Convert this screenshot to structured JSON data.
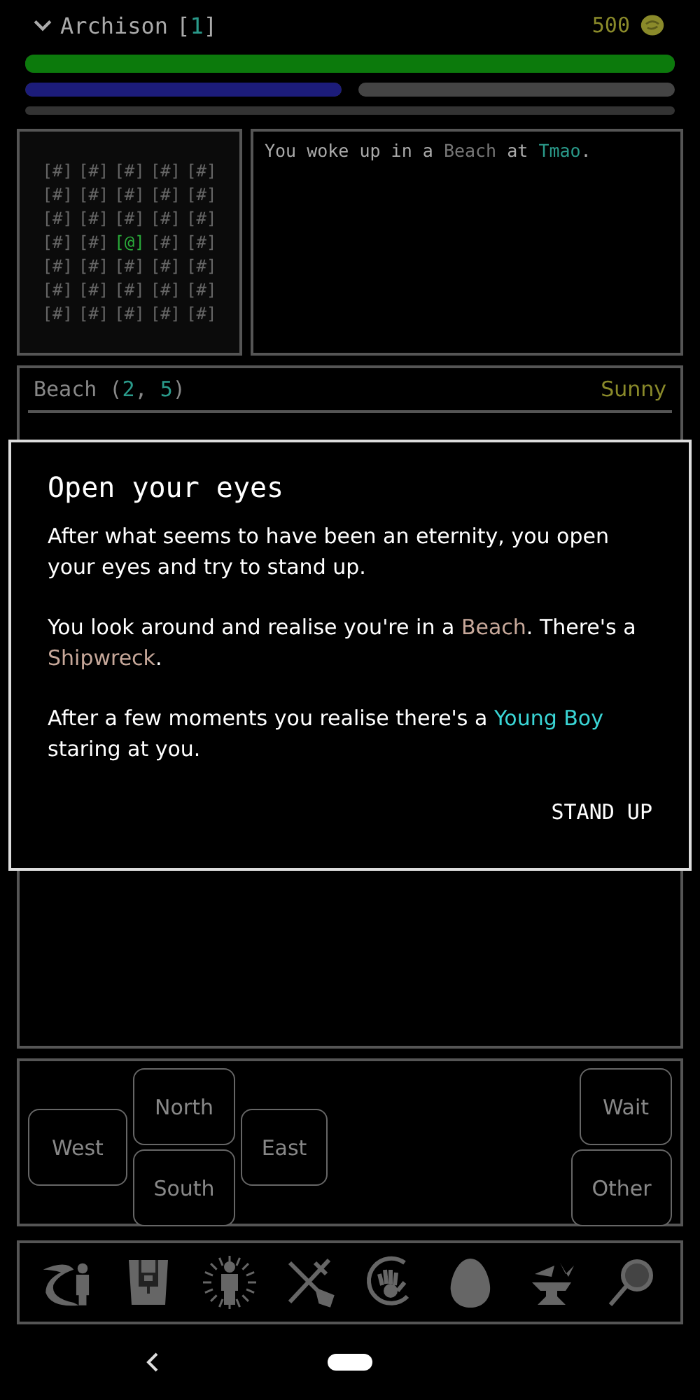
{
  "header": {
    "name": "Archison",
    "level_open": "[",
    "level": "1",
    "level_close": "]",
    "gold": "500"
  },
  "bars": [
    {
      "kind": "health",
      "level": 1
    },
    {
      "kind": "mana",
      "level": 1
    },
    {
      "kind": "stamina"
    },
    {
      "kind": "xp"
    }
  ],
  "map": {
    "rows": [
      [
        {
          "kind": "wall",
          "text": "[#]"
        },
        {
          "kind": "wall",
          "text": "[#]"
        },
        {
          "kind": "wall",
          "text": "[#]"
        },
        {
          "kind": "wall",
          "text": "[#]"
        },
        {
          "kind": "wall",
          "text": "[#]"
        }
      ],
      [
        {
          "kind": "wall",
          "text": "[#]"
        },
        {
          "kind": "wall",
          "text": "[#]"
        },
        {
          "kind": "wall",
          "text": "[#]"
        },
        {
          "kind": "wall",
          "text": "[#]"
        },
        {
          "kind": "wall",
          "text": "[#]"
        }
      ],
      [
        {
          "kind": "wall",
          "text": "[#]"
        },
        {
          "kind": "wall",
          "text": "[#]"
        },
        {
          "kind": "wall",
          "text": "[#]"
        },
        {
          "kind": "wall",
          "text": "[#]"
        },
        {
          "kind": "wall",
          "text": "[#]"
        }
      ],
      [
        {
          "kind": "wall",
          "text": "[#]"
        },
        {
          "kind": "wall",
          "text": "[#]"
        },
        {
          "kind": "player",
          "text": "[@]"
        },
        {
          "kind": "wall",
          "text": "[#]"
        },
        {
          "kind": "wall",
          "text": "[#]"
        }
      ],
      [
        {
          "kind": "wall",
          "text": "[#]"
        },
        {
          "kind": "wall",
          "text": "[#]"
        },
        {
          "kind": "wall",
          "text": "[#]"
        },
        {
          "kind": "wall",
          "text": "[#]"
        },
        {
          "kind": "wall",
          "text": "[#]"
        }
      ],
      [
        {
          "kind": "wall",
          "text": "[#]"
        },
        {
          "kind": "wall",
          "text": "[#]"
        },
        {
          "kind": "wall",
          "text": "[#]"
        },
        {
          "kind": "wall",
          "text": "[#]"
        },
        {
          "kind": "wall",
          "text": "[#]"
        }
      ],
      [
        {
          "kind": "wall",
          "text": "[#]"
        },
        {
          "kind": "wall",
          "text": "[#]"
        },
        {
          "kind": "wall",
          "text": "[#]"
        },
        {
          "kind": "wall",
          "text": "[#]"
        },
        {
          "kind": "wall",
          "text": "[#]"
        }
      ]
    ]
  },
  "log": [
    [
      {
        "kind": "plain",
        "text": "You woke up in a "
      },
      {
        "kind": "place",
        "text": "Beach"
      },
      {
        "kind": "plain",
        "text": " at "
      },
      {
        "kind": "town",
        "text": "Tmao"
      },
      {
        "kind": "plain",
        "text": "."
      }
    ]
  ],
  "location": {
    "parts": [
      {
        "kind": "plain",
        "text": "Beach ("
      },
      {
        "kind": "number",
        "text": "2"
      },
      {
        "kind": "plain",
        "text": ", "
      },
      {
        "kind": "number",
        "text": "5"
      },
      {
        "kind": "plain",
        "text": ")"
      }
    ],
    "weather": "Sunny"
  },
  "dialog": {
    "title": "Open your eyes",
    "paragraphs": [
      [
        {
          "kind": "plain",
          "text": "After what seems to have been an eternity, you open your eyes and try to stand up."
        }
      ],
      [
        {
          "kind": "plain",
          "text": "You look around and realise you're in a "
        },
        {
          "kind": "place",
          "text": "Beach"
        },
        {
          "kind": "plain",
          "text": ". There's a "
        },
        {
          "kind": "place",
          "text": "Shipwreck"
        },
        {
          "kind": "plain",
          "text": "."
        }
      ],
      [
        {
          "kind": "plain",
          "text": "After a few moments you realise there's a "
        },
        {
          "kind": "person",
          "text": "Young Boy"
        },
        {
          "kind": "plain",
          "text": " staring at you."
        }
      ]
    ],
    "action": "STAND UP"
  },
  "controls": [
    {
      "kind": "west",
      "label": "West"
    },
    {
      "kind": "north",
      "label": "North"
    },
    {
      "kind": "south",
      "label": "South"
    },
    {
      "kind": "east",
      "label": "East"
    },
    {
      "kind": "wait",
      "label": "Wait"
    },
    {
      "kind": "other",
      "label": "Other"
    }
  ],
  "toolbar": [
    {
      "kind": "travel"
    },
    {
      "kind": "backpack"
    },
    {
      "kind": "character"
    },
    {
      "kind": "tools"
    },
    {
      "kind": "hand"
    },
    {
      "kind": "egg"
    },
    {
      "kind": "anvil"
    },
    {
      "kind": "magnifier"
    }
  ]
}
